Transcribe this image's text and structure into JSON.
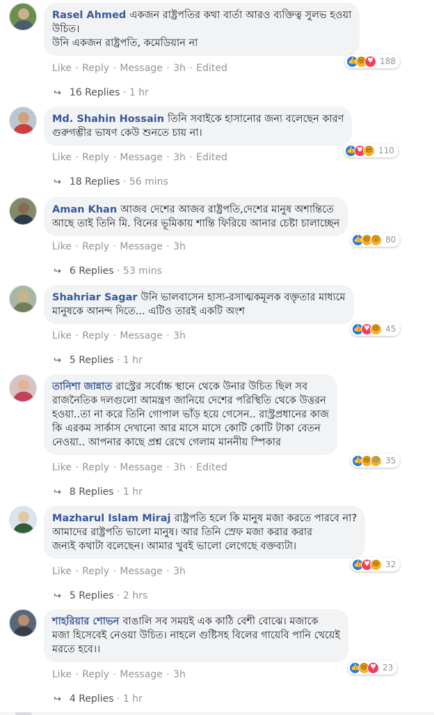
{
  "actions": {
    "like": "Like",
    "reply": "Reply",
    "message": "Message",
    "separator": "·",
    "edited": "Edited"
  },
  "comments": [
    {
      "author": "Rasel Ahmed",
      "text_lines": [
        "একজন রাষ্ট্রপতির কথা বার্তা আরও ব্যক্তিত্ব সুলভ হওয়া",
        "উচিত।",
        "উনি একজন রাষ্ট্রপতি, কমেডিয়ান না"
      ],
      "time": "3h",
      "reactions": [
        "like",
        "haha",
        "love"
      ],
      "reaction_count": "188",
      "replies": "16 Replies",
      "replies_time": "1 hr"
    },
    {
      "author": "Md. Shahin Hossain",
      "text_lines": [
        "তিনি সবাইকে হাসানোর জন্য বলেছেন কারণ",
        "গুরুগম্ভীর ভাষণ কেউ শুনতে চায় না।"
      ],
      "time": "3h",
      "reactions": [
        "like",
        "love",
        "haha"
      ],
      "reaction_count": "110",
      "replies": "18 Replies",
      "replies_time": "56 mins"
    },
    {
      "author": "Aman Khan",
      "text_lines": [
        "আজব দেশের আজব রাষ্ট্রপতি,দেশের মানুষ অশান্তিতে",
        "আছে তাই তিনি মি. বিনের ভূমিকায় শান্তি ফিরিয়ে আনার চেষ্টা চালাচ্ছেন"
      ],
      "time": "3h",
      "reactions": [
        "like",
        "haha",
        "wow"
      ],
      "reaction_count": "80",
      "replies": "6 Replies",
      "replies_time": "53 mins"
    },
    {
      "author": "Shahriar Sagar",
      "text_lines": [
        "উনি ভালবাসেন হাস্য-রসাত্মকমূলক বক্তৃতার মাধ্যমে",
        "মানুষকে আনন্দ দিতে... এটিও তারই একটি অংশ"
      ],
      "time": "3h",
      "reactions": [
        "like",
        "love",
        "haha"
      ],
      "reaction_count": "45",
      "replies": "5 Replies",
      "replies_time": "1 hr"
    },
    {
      "author": "তানিশা জান্নাত",
      "text_lines": [
        "রাস্ট্রের সর্বোচ্চ স্থানে থেকে উনার উচিত ছিল সব",
        "রাজনৈতিক দলগুলো আমন্ত্রণ জানিয়ে দেশের পরিস্থিতি থেকে উত্তরন",
        "হওয়া..তা না করে তিনি গোপাল ভাঁড় হয়ে গেসেন.. রাস্ট্রপ্রধানের কাজ",
        "কি এরকম সার্কাস দেখানো আর মাসে মাসে কোটি কোটি টাকা বেতন",
        "নেওয়া.. আপনার কাছে প্রশ্ন রেখে গেলাম মাননীয় স্পিকার"
      ],
      "time": "3h",
      "reactions": [
        "like",
        "haha",
        "sad"
      ],
      "reaction_count": "35",
      "replies": "8 Replies",
      "replies_time": "1 hr"
    },
    {
      "author": "Mazharul Islam Miraj",
      "text_lines": [
        "রাষ্ট্রপতি হলে কি মানুষ মজা করতে পারবে না?",
        "আমাদের রাষ্ট্রপতি ভালো মানুষ। আর তিনি স্রেফ মজা করার করার",
        "জন্যই কথাটা বলেছেন। আমার খুবই ভালো লেগেছে বক্তব্যটা।"
      ],
      "time": "3h",
      "reactions": [
        "like",
        "love",
        "haha"
      ],
      "reaction_count": "32",
      "replies": "5 Replies",
      "replies_time": "2 hrs"
    },
    {
      "author": "শাহরিয়ার শোভন",
      "text_lines": [
        "বাঙালি সব সময়ই এক কাঠি বেশী বোঝে। মজাকে",
        "মজা হিসেবেই নেওয়া উচিত। নাহলে গুষ্টিসহ বিলের গায়েবি পানি খেয়েই",
        "মরতে হবে।।"
      ],
      "time": "3h",
      "reactions": [
        "like",
        "haha",
        "love"
      ],
      "reaction_count": "23",
      "replies": "4 Replies",
      "replies_time": "1 hr"
    }
  ],
  "reaction_glyphs": {
    "like": "👍",
    "haha": "😆",
    "love": "♥",
    "wow": "😮",
    "sad": "😢"
  },
  "colors": {
    "author": "#385898",
    "bubble": "#f2f3f5",
    "meta": "#90949c",
    "like": "#2078f4",
    "love": "#f33e58",
    "haha": "#f7b125"
  }
}
